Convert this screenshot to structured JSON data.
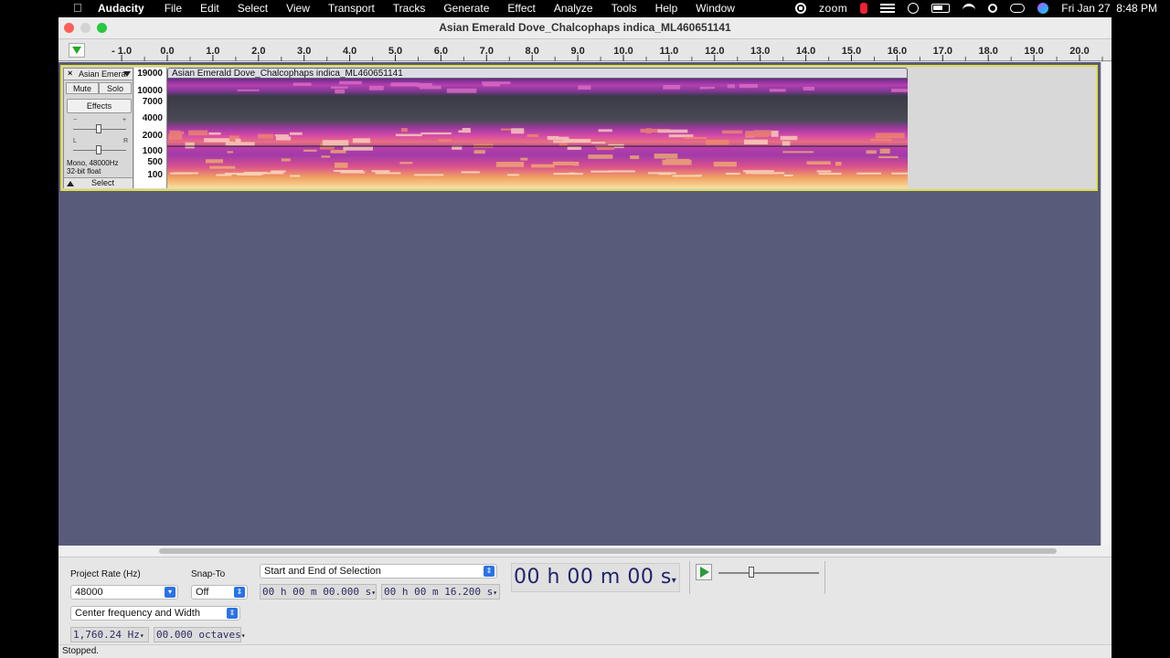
{
  "menubar": {
    "app": "Audacity",
    "items": [
      "File",
      "Edit",
      "Select",
      "View",
      "Transport",
      "Tracks",
      "Generate",
      "Effect",
      "Analyze",
      "Tools",
      "Help",
      "Window"
    ],
    "status_icons": [
      "screen-record-icon",
      "zoom-icon",
      "notification-icon",
      "stack-icon",
      "play-circle-icon",
      "battery-icon",
      "wifi-icon",
      "search-icon",
      "control-center-icon",
      "siri-icon"
    ],
    "zoom_label": "zoom",
    "datetime": "Fri Jan 27  8:48 PM"
  },
  "window": {
    "title": "Asian Emerald Dove_Chalcophaps indica_ML460651141"
  },
  "ruler": {
    "ticks": [
      "- 1.0",
      "0.0",
      "1.0",
      "2.0",
      "3.0",
      "4.0",
      "5.0",
      "6.0",
      "7.0",
      "8.0",
      "9.0",
      "10.0",
      "11.0",
      "12.0",
      "13.0",
      "14.0",
      "15.0",
      "16.0",
      "17.0",
      "18.0",
      "19.0",
      "20.0"
    ]
  },
  "track": {
    "close": "×",
    "name": "Asian Emeral",
    "mute": "Mute",
    "solo": "Solo",
    "effects": "Effects",
    "gain_min": "−",
    "gain_max": "+",
    "pan_left": "L",
    "pan_right": "R",
    "info_line1": "Mono, 48000Hz",
    "info_line2": "32-bit float",
    "select": "Select",
    "freq_labels": [
      "19000",
      "10000",
      "7000",
      "4000",
      "2000",
      "1000",
      "500",
      "100"
    ],
    "clip_title": "Asian Emerald Dove_Chalcophaps indica_ML460651141"
  },
  "selection_toolbar": {
    "project_rate_label": "Project Rate (Hz)",
    "project_rate_value": "48000",
    "snap_to_label": "Snap-To",
    "snap_to_value": "Off",
    "selection_mode": "Start and End of Selection",
    "start_time": "00 h 00 m 00.000 s",
    "end_time": "00 h 00 m 16.200 s",
    "spectral_mode": "Center frequency and Width",
    "center_freq": "1,760.24 Hz",
    "width_octaves": "00.000 octaves",
    "audio_position": "00 h 00 m 00 s"
  },
  "status": {
    "text": "Stopped."
  },
  "colors": {
    "track_area_bg": "#585b7a",
    "track_focus_border": "#dede4a",
    "time_text": "#23236b"
  }
}
